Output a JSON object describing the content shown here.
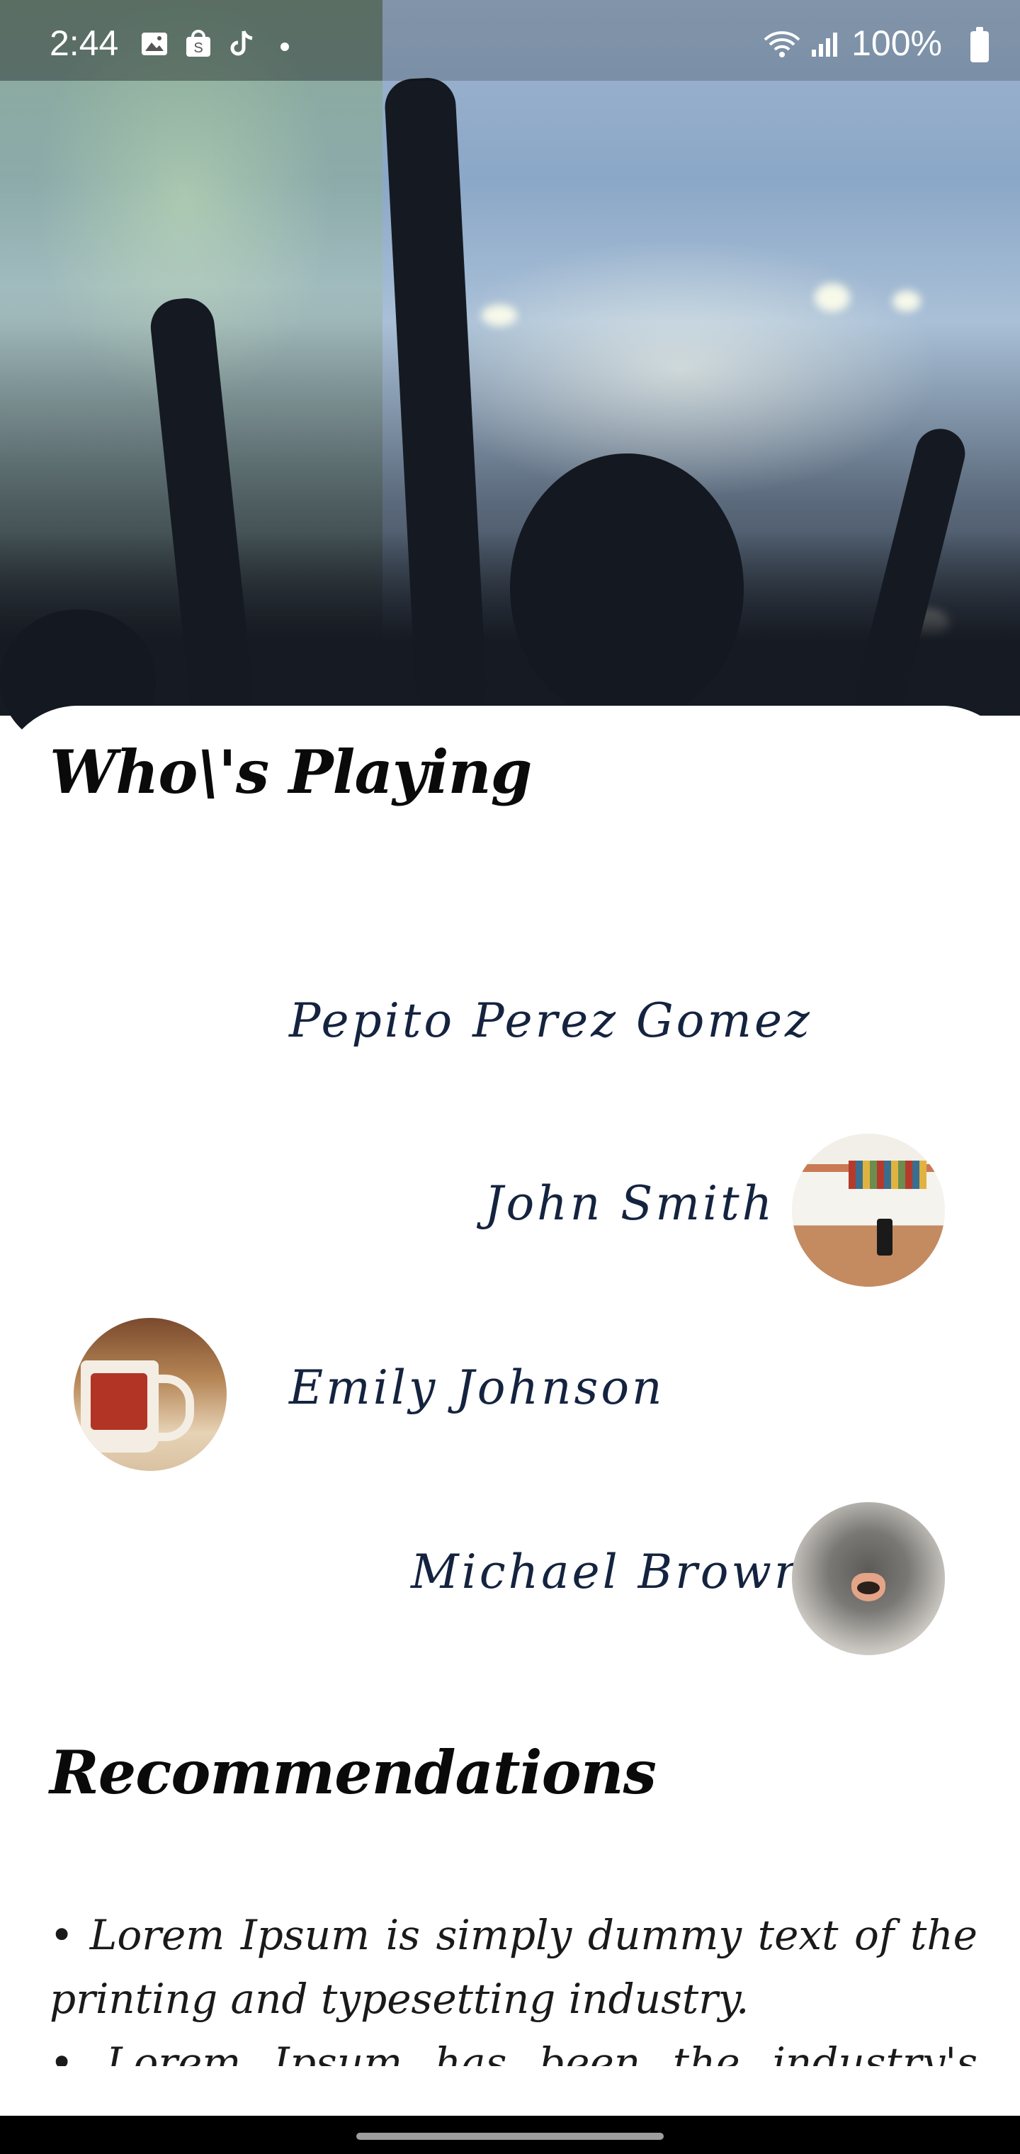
{
  "status_bar": {
    "time": "2:44",
    "battery": "100%",
    "icons": [
      "gallery-icon",
      "shop-icon",
      "tiktok-icon",
      "wifi-icon",
      "signal-icon",
      "battery-icon"
    ]
  },
  "hero": {
    "image": "concert-crowd-image"
  },
  "whos_playing": {
    "title": "Who\\'s Playing",
    "players": [
      {
        "name": "Pepito Perez Gomez",
        "avatar": ""
      },
      {
        "name": "John Smith",
        "avatar": "desk-photo"
      },
      {
        "name": "Emily Johnson",
        "avatar": "mug-photo"
      },
      {
        "name": "Michael Brown",
        "avatar": "cat-nose-photo"
      }
    ]
  },
  "recommendations": {
    "title": "Recommendations",
    "items": [
      "• Lorem Ipsum is simply dummy text of the printing and typesetting industry.",
      "• Lorem Ipsum has been the industry's standard"
    ]
  },
  "colors": {
    "name_text": "#14233f",
    "title_text": "#0a0a0a",
    "nav_bar": "#000000"
  }
}
